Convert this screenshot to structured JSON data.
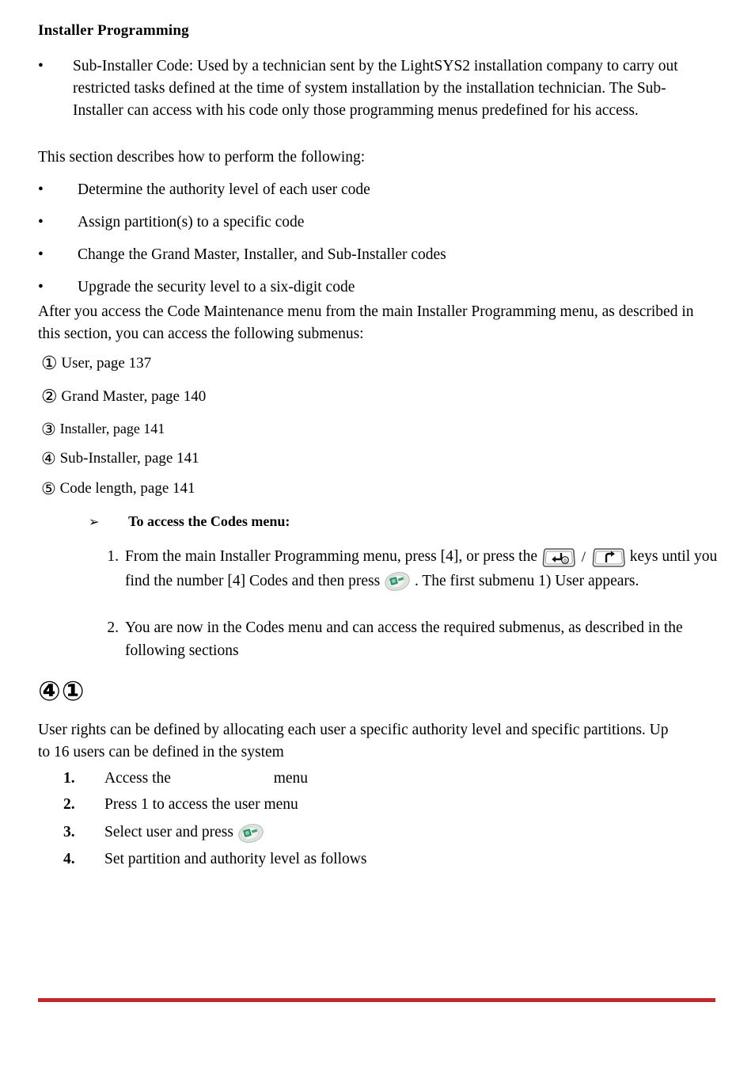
{
  "document": {
    "heading": "Installer Programming",
    "intro_bullets": [
      {
        "bullet": "•",
        "text": "Sub-Installer Code: Used by a technician sent by the LightSYS2 installation company to carry out restricted tasks defined at the time of system installation by the installation technician. The Sub-Installer can access with his code only those programming menus predefined for his access."
      }
    ],
    "section_intro": "This section describes how to perform the following:",
    "task_bullets": [
      {
        "bullet": "•",
        "text": "Determine the authority level of each user code"
      },
      {
        "bullet": "•",
        "text": "Assign partition(s) to a specific code"
      },
      {
        "bullet": "•",
        "text": "Change the Grand Master, Installer, and Sub-Installer codes"
      },
      {
        "bullet": "•",
        "text": "Upgrade the security level to a six-digit code"
      }
    ],
    "submenu_intro": "After you access the Code Maintenance menu from the main Installer Programming menu, as described in this section, you can access the following submenus:",
    "submenus": [
      {
        "marker": "①",
        "label": "User, page 137"
      },
      {
        "marker": "②",
        "label": "Grand Master, page 140"
      },
      {
        "marker": "③",
        "label": "Installer, page 141"
      },
      {
        "marker": "④",
        "label": "Sub-Installer, page 141"
      },
      {
        "marker": "⑤",
        "label": "Code length, page 141"
      }
    ],
    "procedure": {
      "arrow_marker": "➢",
      "title": "To access the Codes menu:",
      "steps": [
        {
          "marker": "1.",
          "text_before_keys": "From the main Installer Programming menu, press [4], or press the",
          "key_separator": "/",
          "text_after_keys": "keys until you find the number [4] Codes and then press",
          "text_after_confirm": ". The first submenu 1) User appears."
        },
        {
          "marker": "2.",
          "text": "You are now in the Codes menu and can access the required submenus, as described in the following sections"
        }
      ]
    },
    "user_section": {
      "heading_markers": "④①",
      "paragraph": "User rights can be defined by allocating each user a specific authority level and specific partitions. Up to 16 users can be defined in the system",
      "steps": [
        {
          "marker": "1.",
          "text_a": "Access the",
          "text_b": "menu"
        },
        {
          "marker": "2.",
          "text_a": "Press 1 to access the user menu",
          "text_b": ""
        },
        {
          "marker": "3.",
          "text_a": "Select user and press",
          "text_b": ""
        },
        {
          "marker": "4.",
          "text_a": "Set partition and authority level as follows",
          "text_b": ""
        }
      ]
    },
    "icons": {
      "scroll_down_key": "keypad-scroll-down-key-icon",
      "scroll_up_key": "keypad-scroll-up-key-icon",
      "confirm_button": "green-confirm-button-icon"
    },
    "colors": {
      "text": "#000000",
      "footer_rule": "#be2a2e",
      "confirm_green": "#3f9d76",
      "confirm_grey": "#d8ded9"
    }
  }
}
